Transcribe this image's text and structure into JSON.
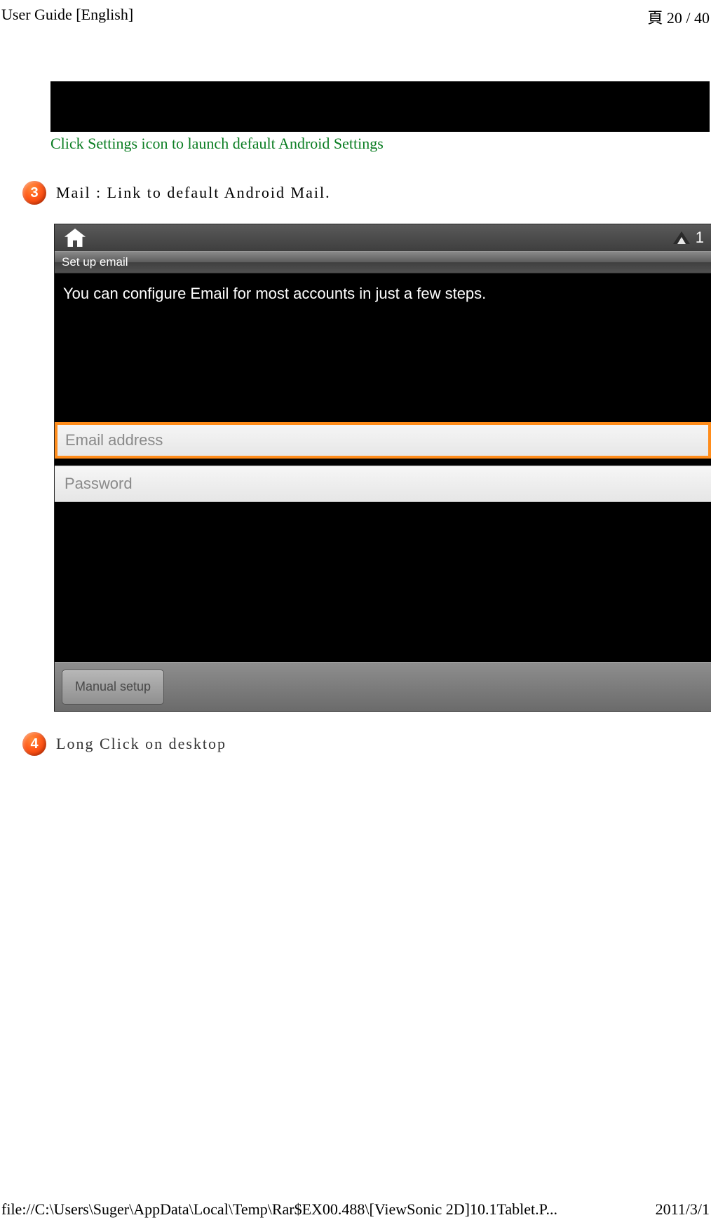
{
  "header": {
    "title": "User Guide [English]",
    "page_indicator": "頁 20 / 40"
  },
  "green_note": "Click Settings icon to launch default Android Settings",
  "bullets": {
    "b3": {
      "num": "3",
      "text": "Mail : Link to default Android Mail."
    },
    "b4": {
      "num": "4",
      "text": "Long Click on desktop"
    }
  },
  "android": {
    "titlebar": "Set up email",
    "instruction": "You can configure Email for most accounts in just a few steps.",
    "email_placeholder": "Email address",
    "password_placeholder": "Password",
    "manual_setup": "Manual setup",
    "clock_digit": "1"
  },
  "footer": {
    "path": "file://C:\\Users\\Suger\\AppData\\Local\\Temp\\Rar$EX00.488\\[ViewSonic 2D]10.1Tablet.P...",
    "date": "2011/3/1"
  }
}
